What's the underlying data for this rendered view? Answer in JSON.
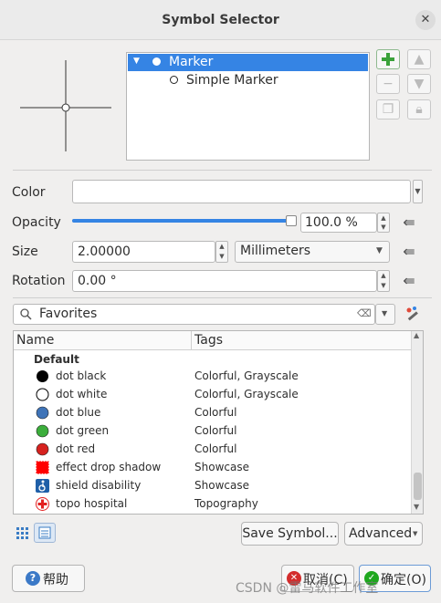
{
  "window": {
    "title": "Symbol Selector",
    "close_glyph": "✕"
  },
  "tree": {
    "root_label": "Marker",
    "child_label": "Simple Marker"
  },
  "layer_buttons": {
    "add": "add-layer-icon",
    "remove": "remove-layer-icon",
    "duplicate": "duplicate-layer-icon",
    "up": "move-up-icon",
    "down": "move-down-icon",
    "lock": "lock-icon"
  },
  "props": {
    "color_label": "Color",
    "opacity_label": "Opacity",
    "opacity_value": "100.0 %",
    "opacity_fraction": 1.0,
    "size_label": "Size",
    "size_value": "2.00000",
    "size_unit": "Millimeters",
    "rotation_label": "Rotation",
    "rotation_value": "0.00 °"
  },
  "search": {
    "value": "Favorites"
  },
  "library": {
    "col_name": "Name",
    "col_tags": "Tags",
    "group": "Default",
    "items": [
      {
        "name": "dot  black",
        "tags": "Colorful, Grayscale",
        "color": "#000000"
      },
      {
        "name": "dot  white",
        "tags": "Colorful, Grayscale",
        "color": "#ffffff"
      },
      {
        "name": "dot blue",
        "tags": "Colorful",
        "color": "#3f74b8"
      },
      {
        "name": "dot green",
        "tags": "Colorful",
        "color": "#3cae3c"
      },
      {
        "name": "dot red",
        "tags": "Colorful",
        "color": "#d6221f"
      },
      {
        "name": "effect drop shadow",
        "tags": "Showcase",
        "color": "#ff0000"
      },
      {
        "name": "shield disability",
        "tags": "Showcase",
        "color": "#1f5fa8"
      },
      {
        "name": "topo hospital",
        "tags": "Topography",
        "color": "#e32121"
      }
    ]
  },
  "bottom": {
    "save_symbol": "Save Symbol...",
    "advanced": "Advanced"
  },
  "footer": {
    "help": "帮助",
    "cancel": "取消(C)",
    "ok": "确定(O)",
    "watermark": "CSDN @雷马软件工作室"
  },
  "colors": {
    "accent": "#3584e4",
    "ok_green": "#1ea71e",
    "cancel_red": "#d32d2d",
    "help_blue": "#3b79c7"
  }
}
